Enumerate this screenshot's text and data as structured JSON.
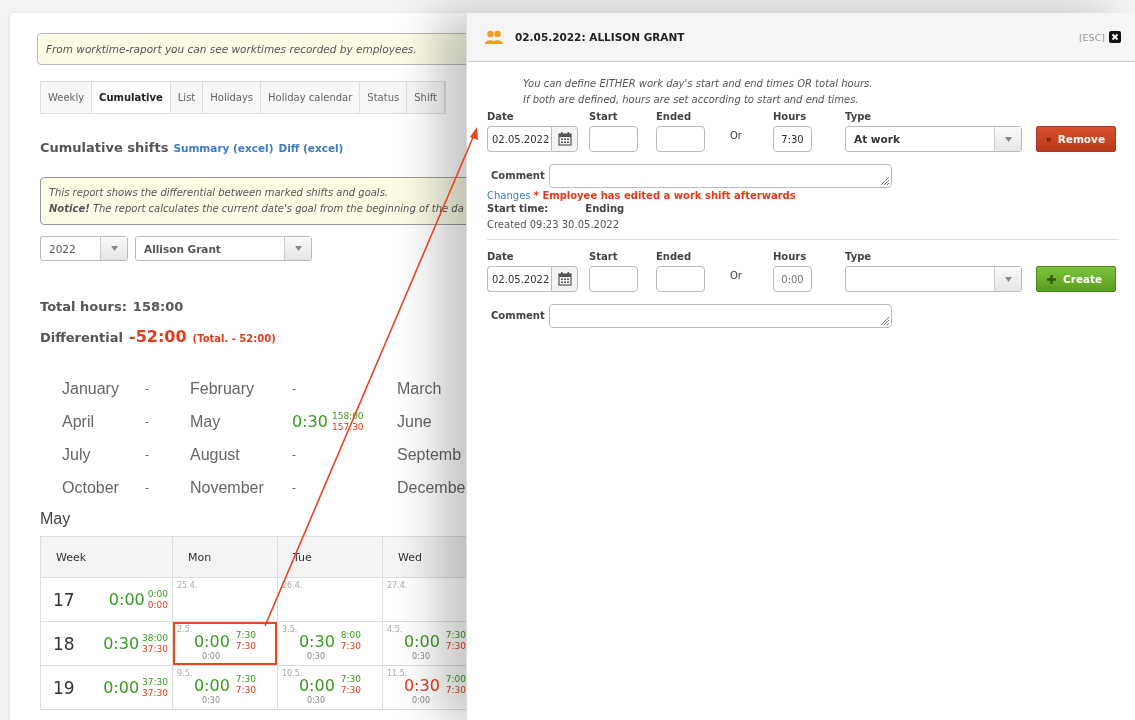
{
  "info_notice": "From worktime-raport you can see worktimes recorded by employees.",
  "tabs": [
    {
      "label": "Weekly",
      "selected": false
    },
    {
      "label": "Cumulative",
      "selected": true
    },
    {
      "label": "List",
      "selected": false
    },
    {
      "label": "Holidays",
      "selected": false
    },
    {
      "label": "Holiday calendar",
      "selected": false
    },
    {
      "label": "Status",
      "selected": false
    },
    {
      "label": "Shift",
      "selected": false
    }
  ],
  "heading": {
    "title": "Cumulative shifts",
    "links": [
      "Summary (excel)",
      "Diff (excel)"
    ]
  },
  "report_notice": [
    "This report shows the differential between marked shifts and goals.",
    "**Notice!** The report calculates the current date's goal from the beginning of the da"
  ],
  "filters": {
    "year": "2022",
    "employee": "Allison Grant"
  },
  "total_hours": {
    "label": "Total hours:",
    "value": "158:00"
  },
  "differential": {
    "label": "Differential",
    "value": "-52:00",
    "note": "(Total. - 52:00)"
  },
  "months": [
    {
      "name": "January",
      "value": "-"
    },
    {
      "name": "February",
      "value": "-"
    },
    {
      "name": "March"
    },
    {
      "name": "April",
      "value": "-"
    },
    {
      "name": "May",
      "value": "0:30",
      "goal": "158:00",
      "done": "157:30"
    },
    {
      "name": "June"
    },
    {
      "name": "July",
      "value": "-"
    },
    {
      "name": "August",
      "value": "-"
    },
    {
      "name": "Septemb"
    },
    {
      "name": "October",
      "value": "-"
    },
    {
      "name": "November",
      "value": "-"
    },
    {
      "name": "Decembe"
    }
  ],
  "month_title": "May",
  "calendar": {
    "columns": [
      "Week",
      "Mon",
      "Tue",
      "Wed"
    ],
    "rows": [
      {
        "week": "17",
        "total": "0:00",
        "goal": "0:00",
        "done": "0:00",
        "days": [
          {
            "date": "25.4.",
            "selected": false
          },
          {
            "date": "26.4.",
            "selected": false
          },
          {
            "date": "27.4.",
            "selected": false
          }
        ]
      },
      {
        "week": "18",
        "total": "0:30",
        "goal": "38:00",
        "done": "37:30",
        "days": [
          {
            "date": "2.5.",
            "total": "0:00",
            "deficit": false,
            "goal": "7:30",
            "done": "7:30",
            "diff": "0:00",
            "selected": true
          },
          {
            "date": "3.5.",
            "total": "0:30",
            "deficit": false,
            "goal": "8:00",
            "done": "7:30",
            "diff": "0:30",
            "selected": false
          },
          {
            "date": "4.5.",
            "total": "0:00",
            "deficit": false,
            "goal": "7:30",
            "done": "7:30",
            "diff": "0:30",
            "selected": false
          }
        ]
      },
      {
        "week": "19",
        "total": "0:00",
        "goal": "37:30",
        "done": "37:30",
        "days": [
          {
            "date": "9.5.",
            "total": "0:00",
            "deficit": false,
            "goal": "7:30",
            "done": "7:30",
            "diff": "0:30",
            "selected": false
          },
          {
            "date": "10.5.",
            "total": "0:00",
            "deficit": false,
            "goal": "7:30",
            "done": "7:30",
            "diff": "0:30",
            "selected": false
          },
          {
            "date": "11.5.",
            "total": "0:30",
            "deficit": true,
            "goal": "7:00",
            "done": "7:30",
            "diff": "0:00",
            "selected": false
          }
        ]
      }
    ]
  },
  "dialog": {
    "title": "02.05.2022: ALLISON GRANT",
    "esc": "[ESC]",
    "hint": [
      "You can define EITHER work day's start and end times OR total hours.",
      "If both are defined, hours are set according to start and end times."
    ],
    "shifts": [
      {
        "labels": {
          "date": "Date",
          "start": "Start",
          "ended": "Ended",
          "or": "Or",
          "hours": "Hours",
          "type": "Type",
          "comment": "Comment"
        },
        "date": "02.05.2022",
        "hours": "7:30",
        "type": "At work",
        "button": {
          "kind": "remove",
          "label": "Remove"
        },
        "changes_link": "Changes",
        "warning": "* Employee has edited a work shift afterwards",
        "start_time_label": "Start time:",
        "ending_label": "Ending",
        "created": "Created 09:23 30.05.2022"
      },
      {
        "labels": {
          "date": "Date",
          "start": "Start",
          "ended": "Ended",
          "or": "Or",
          "hours": "Hours",
          "type": "Type",
          "comment": "Comment"
        },
        "date": "02.05.2022",
        "hours_placeholder": "0:00",
        "button": {
          "kind": "create",
          "label": "Create"
        }
      }
    ]
  }
}
